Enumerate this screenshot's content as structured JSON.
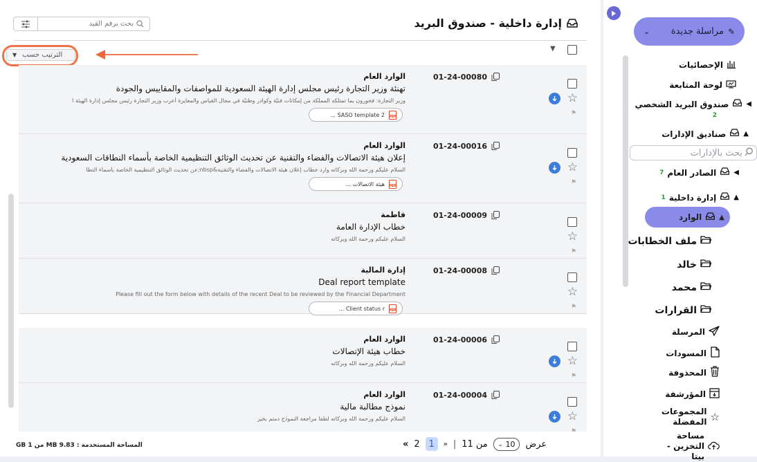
{
  "header": {
    "title": "إدارة داخلية - صندوق البريد",
    "search_placeholder": "بحث برقم القيد",
    "sort_label": "الترتيب حسب"
  },
  "sidebar": {
    "new_mail": "مراسلة جديدة",
    "search_placeholder": "بحث بالإدارات",
    "items": [
      {
        "label": "الإحصائيات"
      },
      {
        "label": "لوحة المتابعة"
      },
      {
        "label": "صندوق البريد الشخصي",
        "count": "2"
      },
      {
        "label": "صناديق الإدارات"
      },
      {
        "label": "الصادر العام",
        "count": "7"
      },
      {
        "label": "إدارة داخلية",
        "count": "1"
      },
      {
        "label": "الوارد"
      },
      {
        "label": "ملف الخطابات"
      },
      {
        "label": "خالد"
      },
      {
        "label": "محمد"
      },
      {
        "label": "القرارات"
      },
      {
        "label": "المرسلة"
      },
      {
        "label": "المسودات"
      },
      {
        "label": "المحذوفة"
      },
      {
        "label": "المؤرشفة"
      },
      {
        "label": "المجموعات المفضلة"
      },
      {
        "label": "مساحة التخزين - بيتا"
      }
    ]
  },
  "rows": [
    {
      "number": "01-24-00080",
      "sender": "الوارد العام",
      "subject": "تهنئة وزير التجارة رئيس مجلس إدارة الهيئة السعودية للمواصفات والمقاييس والجودة",
      "preview": "وزير التجارة: فخورون بما تمتلكه المملكة من إمكانات فنيّة وكوادر وطنيّة في مجال القياس والمعايرة أعرب وزير التجارة رئيس مجلس إدارة الهيئة ا",
      "attachment": "SASO template 2 ...",
      "has_download": true
    },
    {
      "number": "01-24-00016",
      "sender": "الوارد العام",
      "subject": "إعلان هيئة الاتصالات والفضاء والتقنية عن تحديث الوثائق التنظيمية الخاصة بأسماء النطاقات السعودية",
      "preview": "السلام عليكم ورحمة الله وبركاته وارد خطاب إعلان هيئة الاتصالات والفضاء والتقنية&nbsp;عن تحديث الوثائق التنظيمية الخاصة بأسماء النطا",
      "attachment": "هيئة الاتصالات ...",
      "has_download": true
    },
    {
      "number": "01-24-00009",
      "sender": "فاطمة",
      "subject": "خطاب الإدارة العامة",
      "preview": "السلام عليكم ورحمة الله وبركاته",
      "attachment": "",
      "has_download": false
    },
    {
      "number": "01-24-00008",
      "sender": "إدارة المالية",
      "subject": "Deal report template",
      "preview": "Please fill out the form below with details of the recent Deal to be reviewed by the Financial Department",
      "attachment": "Client status r ...",
      "has_download": false
    },
    {
      "number": "01-24-00006",
      "sender": "الوارد العام",
      "subject": "خطاب هيئة الإتصالات",
      "preview": "السلام عليكم ورحمة الله وبركاته",
      "attachment": "",
      "has_download": true
    },
    {
      "number": "01-24-00004",
      "sender": "الوارد العام",
      "subject": "نموذج مطالبة مالية",
      "preview": "السلام عليكم ورحمة الله وبركاته لطفا مراجعة النموذج دمتم بخير",
      "attachment": "",
      "has_download": true
    }
  ],
  "footer": {
    "storage_used": "المساحة المستخدمة : 9.83 MB من 1 GB",
    "show_label": "عرض",
    "per_page": "10",
    "of_label": "من 11",
    "page_current": "1",
    "page_next": "2",
    "prev_glyph": "«",
    "next_glyph": "»"
  }
}
